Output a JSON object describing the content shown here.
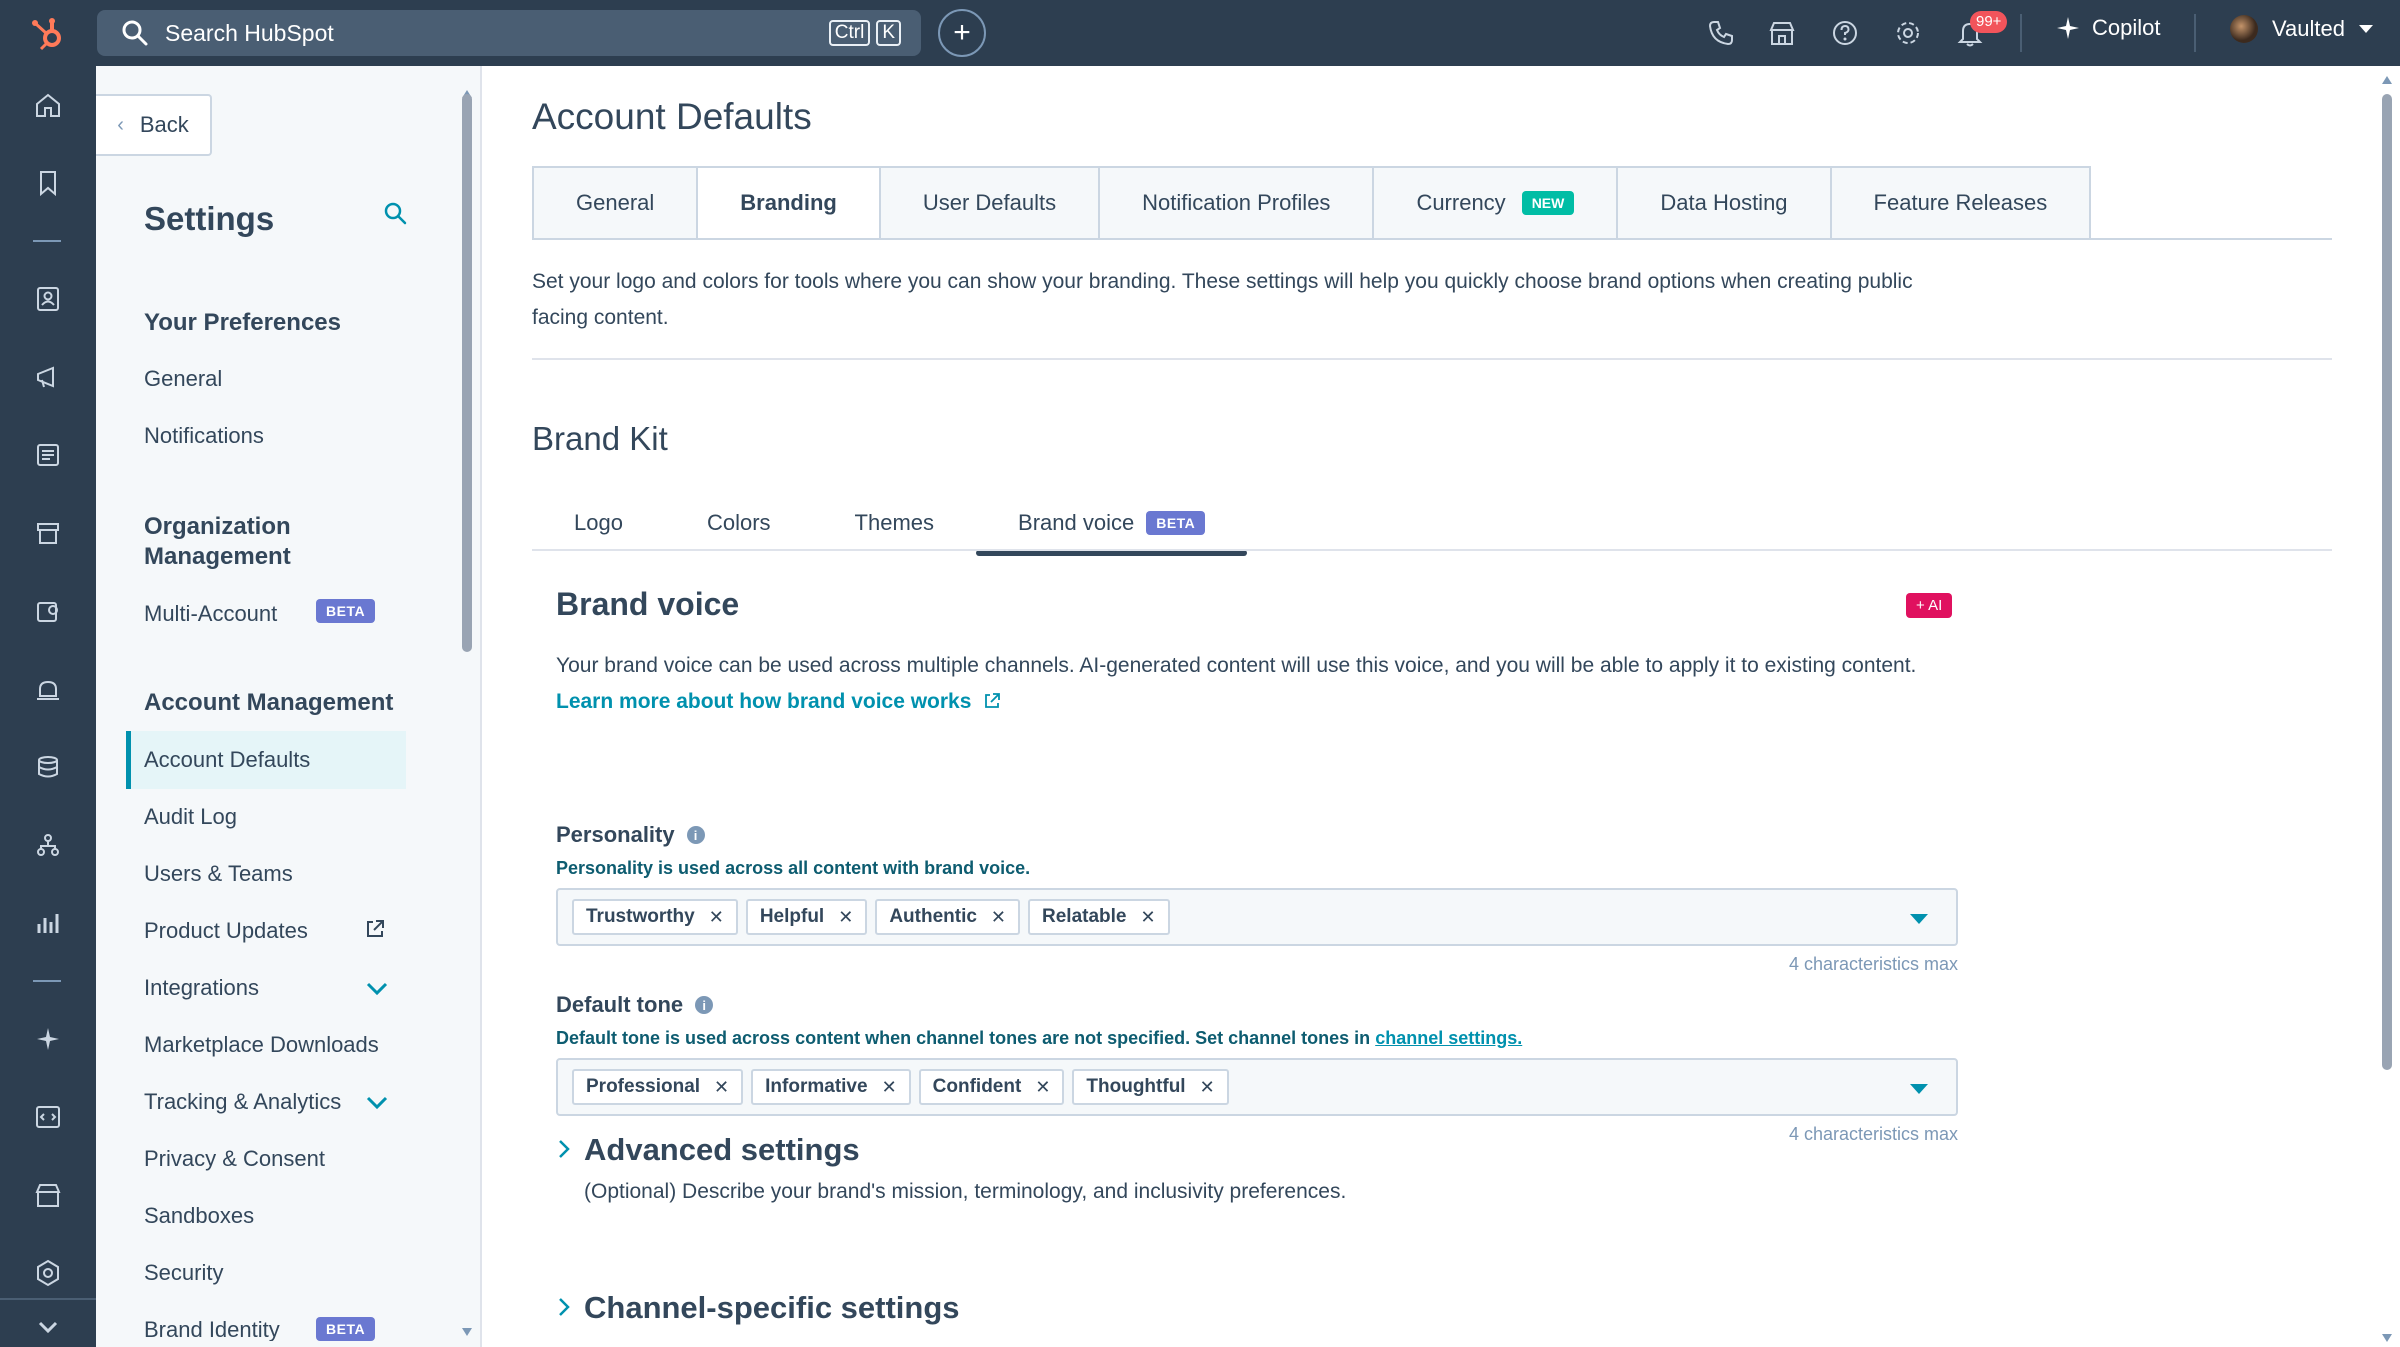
{
  "topbar": {
    "search_placeholder": "Search HubSpot",
    "shortcut_key1": "Ctrl",
    "shortcut_key2": "K",
    "plus_label": "+",
    "notifications_count": "99+",
    "copilot_label": "Copilot",
    "account_name": "Vaulted",
    "icons": [
      "hubspot-logo-icon",
      "search-icon",
      "phone-icon",
      "marketplace-icon",
      "help-icon",
      "settings-icon",
      "bell-icon",
      "copilot-sparkle-icon"
    ]
  },
  "rail": {
    "icons": [
      "home-icon",
      "bookmark-icon",
      "contacts-icon",
      "marketing-icon",
      "content-icon",
      "commerce-icon",
      "service-icon",
      "automation-icon",
      "data-management-icon",
      "workflows-icon",
      "reporting-icon",
      "breeze-ai-icon",
      "developer-icon",
      "app-marketplace-icon",
      "settings-hub-icon",
      "expand-icon"
    ]
  },
  "sidebar": {
    "back_label": "Back",
    "title": "Settings",
    "sections": {
      "preferences": "Your Preferences",
      "organization": "Organization Management",
      "account": "Account Management"
    },
    "items": {
      "general": "General",
      "notifications": "Notifications",
      "multi_account": "Multi-Account",
      "multi_account_badge": "BETA",
      "account_defaults": "Account Defaults",
      "audit_log": "Audit Log",
      "users_teams": "Users & Teams",
      "product_updates": "Product Updates",
      "integrations": "Integrations",
      "marketplace_downloads": "Marketplace Downloads",
      "tracking_analytics": "Tracking & Analytics",
      "privacy_consent": "Privacy & Consent",
      "sandboxes": "Sandboxes",
      "security": "Security",
      "brand_identity": "Brand Identity",
      "brand_identity_badge": "BETA"
    }
  },
  "main": {
    "page_title": "Account Defaults",
    "tabs": [
      {
        "label": "General"
      },
      {
        "label": "Branding"
      },
      {
        "label": "User Defaults"
      },
      {
        "label": "Notification Profiles"
      },
      {
        "label": "Currency",
        "badge": "NEW"
      },
      {
        "label": "Data Hosting"
      },
      {
        "label": "Feature Releases"
      }
    ],
    "description": "Set your logo and colors for tools where you can show your branding. These settings will help you quickly choose brand options when creating public facing content.",
    "brand_kit_title": "Brand Kit",
    "subtabs": [
      {
        "label": "Logo"
      },
      {
        "label": "Colors"
      },
      {
        "label": "Themes"
      },
      {
        "label": "Brand voice",
        "badge": "BETA"
      }
    ],
    "brand_voice": {
      "title": "Brand voice",
      "ai_badge": "+ AI",
      "description": "Your brand voice can be used across multiple channels. AI-generated content will use this voice, and you will be able to apply it to existing content.",
      "learn_more": "Learn more about how brand voice works",
      "personality": {
        "label": "Personality",
        "help": "Personality is used across all content with brand voice.",
        "tags": [
          "Trustworthy",
          "Helpful",
          "Authentic",
          "Relatable"
        ],
        "max_note": "4 characteristics max"
      },
      "default_tone": {
        "label": "Default tone",
        "help": "Default tone is used across content when channel tones are not specified. Set channel tones in",
        "help_link": "channel settings.",
        "tags": [
          "Professional",
          "Informative",
          "Confident",
          "Thoughtful"
        ],
        "max_note": "4 characteristics max"
      },
      "advanced": {
        "title": "Advanced settings",
        "description": "(Optional) Describe your brand's mission, terminology, and inclusivity preferences."
      },
      "channel": {
        "title": "Channel-specific settings"
      }
    }
  },
  "colors": {
    "nav_bg": "#2d3e50",
    "accent": "#0091ae",
    "beta": "#6a78d1",
    "new": "#00bda5",
    "ai": "#e0115f"
  }
}
